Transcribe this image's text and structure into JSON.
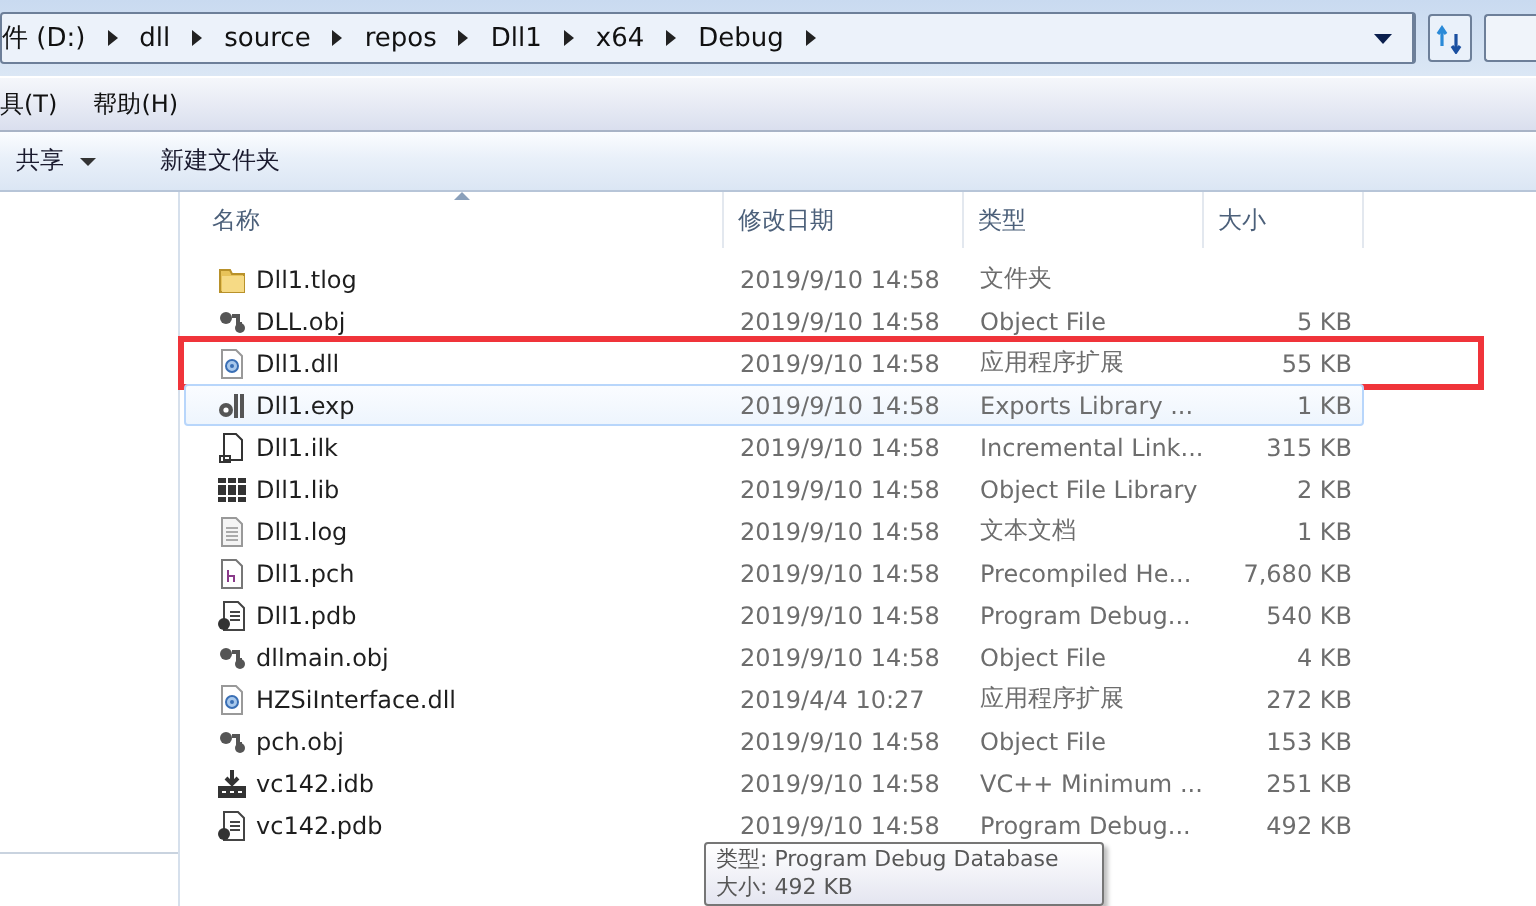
{
  "address_bar": {
    "crumbs": [
      "件 (D:)",
      "dll",
      "source",
      "repos",
      "Dll1",
      "x64",
      "Debug"
    ]
  },
  "menu_bar": {
    "items": [
      "具(T)",
      "帮助(H)"
    ]
  },
  "toolbar": {
    "items": [
      {
        "label": "共享",
        "kind": "dropdown"
      },
      {
        "label": "新建文件夹",
        "kind": "button"
      }
    ]
  },
  "file_list": {
    "columns": [
      {
        "label": "名称",
        "sorted": true
      },
      {
        "label": "修改日期",
        "sorted": false
      },
      {
        "label": "类型",
        "sorted": false
      },
      {
        "label": "大小",
        "sorted": false
      }
    ],
    "rows": [
      {
        "kind": "folder",
        "name": "Dll1.tlog",
        "date": "2019/9/10 14:58",
        "type": "文件夹",
        "size": "",
        "hovered": false,
        "marked": false
      },
      {
        "kind": "obj",
        "name": "DLL.obj",
        "date": "2019/9/10 14:58",
        "type": "Object File",
        "size": "5 KB",
        "hovered": false,
        "marked": false
      },
      {
        "kind": "dll",
        "name": "Dll1.dll",
        "date": "2019/9/10 14:58",
        "type": "应用程序扩展",
        "size": "55 KB",
        "hovered": false,
        "marked": true
      },
      {
        "kind": "exp",
        "name": "Dll1.exp",
        "date": "2019/9/10 14:58",
        "type": "Exports Library ...",
        "size": "1 KB",
        "hovered": true,
        "marked": false
      },
      {
        "kind": "ilk",
        "name": "Dll1.ilk",
        "date": "2019/9/10 14:58",
        "type": "Incremental Link...",
        "size": "315 KB",
        "hovered": false,
        "marked": false
      },
      {
        "kind": "lib",
        "name": "Dll1.lib",
        "date": "2019/9/10 14:58",
        "type": "Object File Library",
        "size": "2 KB",
        "hovered": false,
        "marked": false
      },
      {
        "kind": "text",
        "name": "Dll1.log",
        "date": "2019/9/10 14:58",
        "type": "文本文档",
        "size": "1 KB",
        "hovered": false,
        "marked": false
      },
      {
        "kind": "pch",
        "name": "Dll1.pch",
        "date": "2019/9/10 14:58",
        "type": "Precompiled He...",
        "size": "7,680 KB",
        "hovered": false,
        "marked": false
      },
      {
        "kind": "pdb",
        "name": "Dll1.pdb",
        "date": "2019/9/10 14:58",
        "type": "Program Debug...",
        "size": "540 KB",
        "hovered": false,
        "marked": false
      },
      {
        "kind": "obj",
        "name": "dllmain.obj",
        "date": "2019/9/10 14:58",
        "type": "Object File",
        "size": "4 KB",
        "hovered": false,
        "marked": false
      },
      {
        "kind": "dll",
        "name": "HZSiInterface.dll",
        "date": "2019/4/4 10:27",
        "type": "应用程序扩展",
        "size": "272 KB",
        "hovered": false,
        "marked": false
      },
      {
        "kind": "obj",
        "name": "pch.obj",
        "date": "2019/9/10 14:58",
        "type": "Object File",
        "size": "153 KB",
        "hovered": false,
        "marked": false
      },
      {
        "kind": "idb",
        "name": "vc142.idb",
        "date": "2019/9/10 14:58",
        "type": "VC++ Minimum ...",
        "size": "251 KB",
        "hovered": false,
        "marked": false
      },
      {
        "kind": "pdb",
        "name": "vc142.pdb",
        "date": "2019/9/10 14:58",
        "type": "Program Debug...",
        "size": "492 KB",
        "hovered": false,
        "marked": false
      }
    ]
  },
  "tooltip": {
    "lines": [
      "类型: Program Debug Database",
      "大小: 492 KB"
    ]
  }
}
